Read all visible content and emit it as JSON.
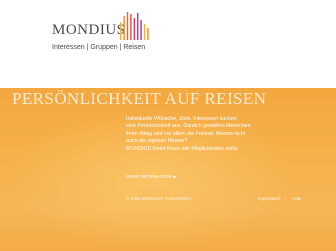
{
  "brand": {
    "name": "MONDIUS",
    "tagline": "Interessen | Gruppen | Reisen",
    "bar_colors": [
      "#f2b233",
      "#ef8a2a",
      "#e9642b",
      "#e24a45",
      "#d93a7a",
      "#b6358f",
      "#8e3a9a",
      "#f2b233",
      "#ef8a2a"
    ]
  },
  "hero": {
    "headline": "PERSÖNLICHKEIT AUF REISEN",
    "intro_lines": [
      "Individuelle Wünsche, Ziele, Interessen suchen",
      "eine Persönlichkeit aus. Danach gestalten Menschen",
      "ihren Alltag und vor allem die Freizeit. Warum nicht",
      "auch die eigenen Reisen?",
      "MONDIUS bietet Ihnen alle Möglichkeiten dafür."
    ],
    "more_link": "MEHR INFORMATION",
    "more_arrow": "▶"
  },
  "footer": {
    "copyright": "© 2008 MONDIUS Travel GmbH",
    "links": [
      "Impressum",
      "AGB"
    ],
    "separator": "|"
  },
  "colors": {
    "orange": "#f5b04a",
    "text_dark": "#4a4a4a"
  }
}
